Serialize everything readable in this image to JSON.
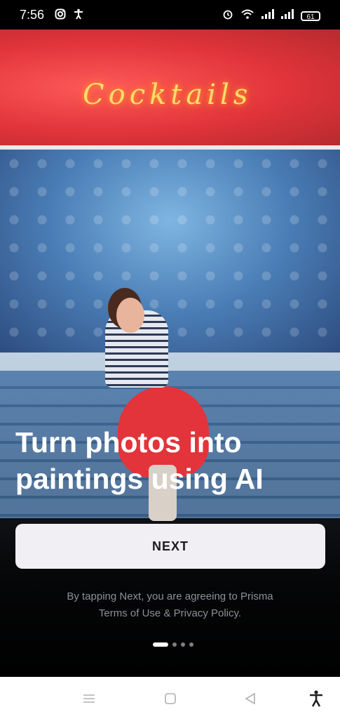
{
  "status_bar": {
    "time": "7:56",
    "battery": "61",
    "left_icons": [
      "instagram-icon",
      "accessibility-icon"
    ],
    "right_icons": [
      "alarm-icon",
      "wifi-icon",
      "signal-icon",
      "signal-icon",
      "battery-icon"
    ]
  },
  "hero": {
    "neon_sign": "Cocktails"
  },
  "onboarding": {
    "headline_line1": "Turn photos into",
    "headline_line2": "paintings using AI",
    "next_button": "NEXT",
    "legal_prefix": "By tapping Next, you are agreeing to Prisma",
    "terms_link": "Terms of Use",
    "legal_and": "&",
    "privacy_link": "Privacy Policy",
    "legal_suffix": ".",
    "pager": {
      "total": 4,
      "active_index": 0
    }
  },
  "nav_bar": {
    "icons": [
      "menu-icon",
      "home-square-icon",
      "back-triangle-icon",
      "accessibility-icon"
    ]
  },
  "colors": {
    "button_bg": "#f1eff4",
    "text_white": "#ffffff",
    "legal_gray": "#8d9098"
  }
}
